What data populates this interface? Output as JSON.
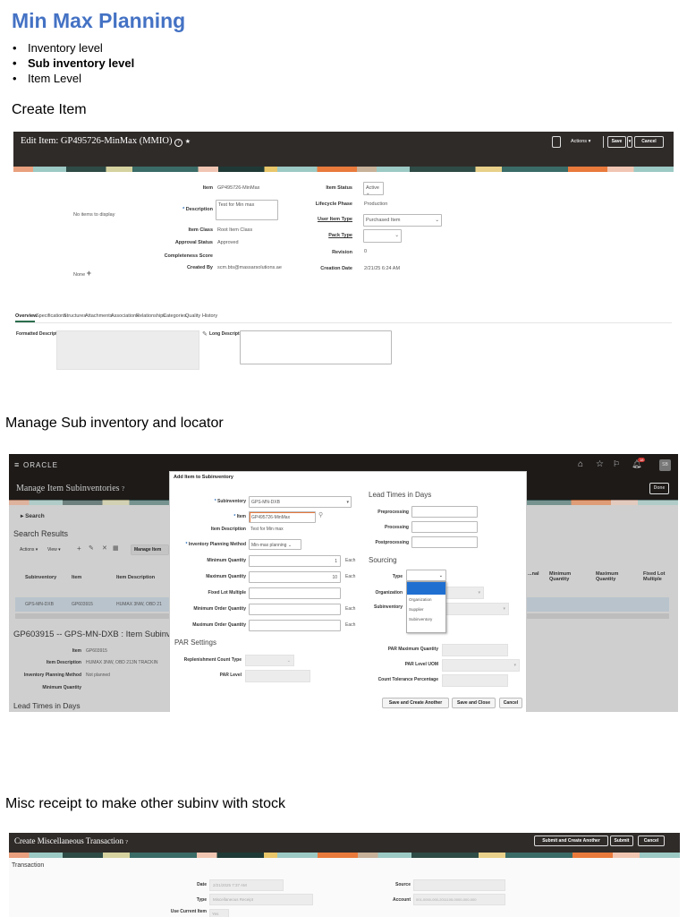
{
  "doc": {
    "title": "Min Max Planning",
    "bullets": [
      "Inventory level",
      "Sub inventory level",
      "Item Level"
    ],
    "bullet_char": "•",
    "sections": [
      "Create Item",
      "Manage Sub inventory and locator",
      "Misc receipt to make other subinv with stock"
    ]
  },
  "edit_item": {
    "title": "Edit Item: GP495726-MinMax (MMIO)",
    "help": "?",
    "star": "★",
    "actions_label": "Actions ▾",
    "save_label": "Save",
    "save_menu": "▾",
    "cancel_label": "Cancel",
    "no_items": "No items to display",
    "none_label": "None",
    "plus": "+",
    "left_fields": [
      {
        "label": "Item",
        "value": "GP495726-MinMax"
      },
      {
        "label": "Description",
        "value": "Test for Min max"
      },
      {
        "label": "Item Class",
        "value": "Root Item Class"
      },
      {
        "label": "Approval Status",
        "value": "Approved"
      },
      {
        "label": "Completeness Score",
        "value": ""
      },
      {
        "label": "Created By",
        "value": "scm.bts@massarsolutions.ae"
      }
    ],
    "right_fields": [
      {
        "label": "Item Status",
        "value": "Active"
      },
      {
        "label": "Lifecycle Phase",
        "value": "Production"
      },
      {
        "label": "User Item Type",
        "value": "Purchased Item"
      },
      {
        "label": "Pack Type",
        "value": ""
      },
      {
        "label": "Revision",
        "value": "0"
      },
      {
        "label": "Creation Date",
        "value": "2/21/25 6:24 AM"
      }
    ],
    "tabs": [
      "Overview",
      "Specifications",
      "Structures",
      "Attachments",
      "Associations",
      "Relationships",
      "Categories",
      "Quality",
      "History"
    ],
    "formatted_description_label": "Formatted Description",
    "long_description_label": "Long Description"
  },
  "subinv": {
    "brand": "ORACLE",
    "page_title": "Manage Item Subinventories",
    "help": "?",
    "notification_count": "18",
    "avatar": "SB",
    "done_label": "Done",
    "search_label": "Search",
    "results_heading": "Search Results",
    "toolbar": {
      "actions": "Actions ▾",
      "view": "View ▾",
      "manage": "Manage Item"
    },
    "columns_left": [
      "Subinventory",
      "Item",
      "Item Description"
    ],
    "columns_right": [
      "...nal ...tion",
      "Minimum Quantity",
      "Maximum Quantity",
      "Fixed Lot Multiple"
    ],
    "row": [
      "GPS-MN-DXB",
      "GP603915",
      "HUMAX 3NW, OBD 21"
    ],
    "detail_heading": "GP603915 -- GPS-MN-DXB : Item Subinv",
    "detail_fields": [
      {
        "label": "Item",
        "value": "GP603915"
      },
      {
        "label": "Item Description",
        "value": "HUMAX 3NW, OBD 213N TRACKIN"
      },
      {
        "label": "Inventory Planning Method",
        "value": "Not planned"
      },
      {
        "label": "Minimum Quantity",
        "value": ""
      }
    ],
    "lead_heading": "Lead Times in Days",
    "dialog": {
      "title": "Add Item to Subinventory",
      "subinventory_label": "Subinventory",
      "subinventory_value": "GPS-MN-DXB",
      "item_label": "Item",
      "item_value": "GP495726-MinMax",
      "item_desc_label": "Item Description",
      "item_desc_value": "Test for Min max",
      "ipm_label": "Inventory Planning Method",
      "ipm_value": "Min-max planning",
      "min_qty_label": "Minimum Quantity",
      "min_qty_value": "1",
      "max_qty_label": "Maximum Quantity",
      "max_qty_value": "10",
      "fixed_lot_label": "Fixed Lot Multiple",
      "min_order_label": "Minimum Order Quantity",
      "max_order_label": "Maximum Order Quantity",
      "uom": "Each",
      "par_heading": "PAR Settings",
      "repl_label": "Replenishment Count Type",
      "par_level_label": "PAR Level",
      "lead_heading": "Lead Times in Days",
      "pre_label": "Preprocessing",
      "proc_label": "Processing",
      "post_label": "Postprocessing",
      "sourcing_heading": "Sourcing",
      "type_label": "Type",
      "org_label": "Organization",
      "sub_label": "Subinventory",
      "type_options": [
        "",
        "Organization",
        "Supplier",
        "Subinventory"
      ],
      "par_max_label": "PAR Maximum Quantity",
      "par_uom_label": "PAR Level UOM",
      "count_tol_label": "Count Tolerance Percentage",
      "save_another": "Save and Create Another",
      "save_close": "Save and Close",
      "cancel": "Cancel"
    }
  },
  "misc": {
    "title": "Create Miscellaneous Transaction",
    "help": "?",
    "submit_another": "Submit and Create Another",
    "submit": "Submit",
    "cancel": "Cancel",
    "section": "Transaction",
    "date_label": "Date",
    "date_value": "2/21/2025 7:37 AM",
    "type_label": "Type",
    "type_value": "Miscellaneous Receipt",
    "use_current_label": "Use Current Item",
    "use_current_value": "Yes",
    "source_label": "Source",
    "account_label": "Account",
    "account_value": "001-0000-000-2011105-0000-000-000"
  }
}
